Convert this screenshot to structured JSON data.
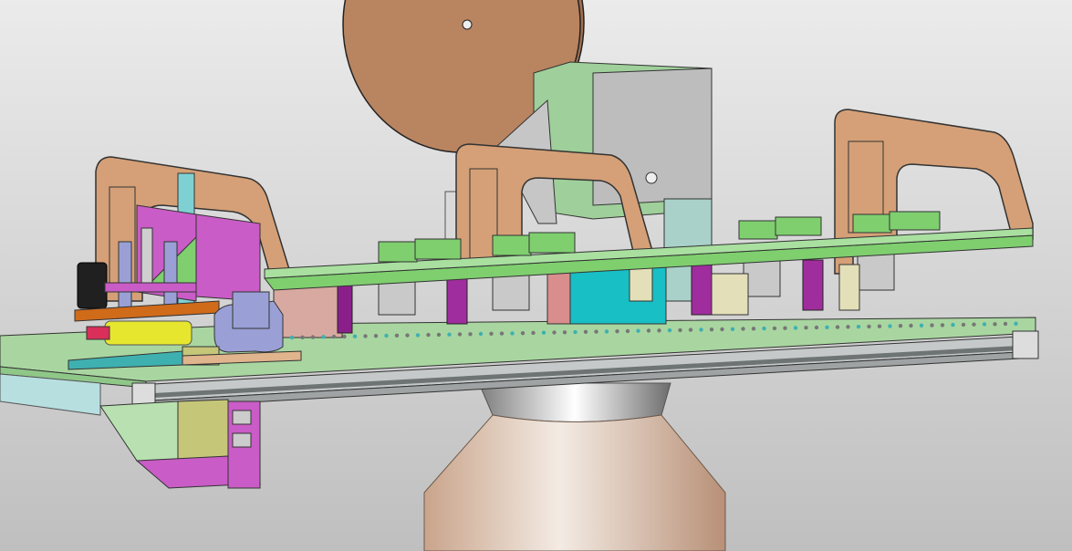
{
  "app": {
    "type": "3D CAD model viewport",
    "visible_text": []
  },
  "viewport": {
    "background_gradient": [
      "#ebebeb",
      "#bfbfbf"
    ]
  },
  "palette": {
    "wood_wheel": "#b98460",
    "wood_wheel_dark": "#a26f4f",
    "arch_brown": "#d5a077",
    "arch_brown_dark": "#c48c62",
    "base_plate_green": "#a9d6a0",
    "base_plate_green_dark": "#8fc788",
    "rail_green": "#7fcf6f",
    "rail_green_dark": "#5fb651",
    "extrusion_gray": "#9fa3a3",
    "extrusion_gray_dark": "#6e7373",
    "box_gray": "#b9b9b9",
    "box_green": "#9fcf9a",
    "magenta": "#c95cc6",
    "purple_dark": "#8a1f8a",
    "cyan": "#18bfc5",
    "teal": "#3fb0b0",
    "yellow": "#e6e62f",
    "yellow_olive": "#c6c679",
    "lavender": "#9aa0d6",
    "salmon": "#d98d8d",
    "orange": "#d06b1a",
    "pedestal_tan": "#d5b29a",
    "pedestal_light": "#f0e6de",
    "cream": "#e3dfb8",
    "black": "#202020"
  }
}
